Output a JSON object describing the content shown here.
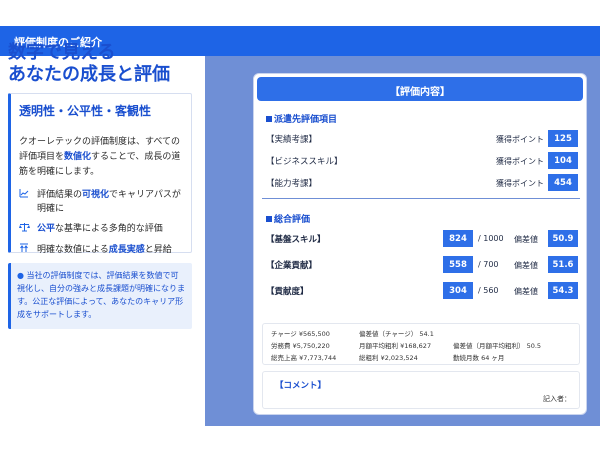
{
  "header": {
    "title": "評価制度のご紹介"
  },
  "left": {
    "headline_line1": "数字で見える",
    "headline_line2": "あなたの成長と評価",
    "card": {
      "title": "透明性・公平性・客観性",
      "desc_a": "クオーレテックの評価制度は、すべての評価項目を",
      "desc_hl": "数値化",
      "desc_b": "することで、成長の道筋を明確にします。",
      "features": [
        {
          "icon": "chart-line-icon",
          "a": "評価結果の",
          "hl": "可視化",
          "b": "でキャリアパスが明確に"
        },
        {
          "icon": "scale-icon",
          "a": "",
          "hl": "公平",
          "b": "な基準による多角的な評価"
        },
        {
          "icon": "stairs-icon",
          "a": "明確な数値による",
          "hl": "成長実感",
          "b": "と昇給"
        }
      ]
    },
    "note": "当社の評価制度では、評価結果を数値で可視化し、自分の強みと成長課題が明確になります。公正な評価によって、あなたのキャリア形成をサポートします。"
  },
  "panel": {
    "title": "【評価内容】",
    "section1": "派遣先評価項目",
    "items": [
      {
        "label": "【実績考課】",
        "points_label": "獲得ポイント",
        "value": "125"
      },
      {
        "label": "【ビジネススキル】",
        "points_label": "獲得ポイント",
        "value": "104"
      },
      {
        "label": "【能力考課】",
        "points_label": "獲得ポイント",
        "value": "454"
      }
    ],
    "section2": "総合評価",
    "totals": [
      {
        "label": "【基盤スキル】",
        "score": "824",
        "max": "/ 1000",
        "dev_label": "偏差値",
        "dev": "50.9"
      },
      {
        "label": "【企業貢献】",
        "score": "558",
        "max": "/ 700",
        "dev_label": "偏差値",
        "dev": "51.6"
      },
      {
        "label": "【貢献度】",
        "score": "304",
        "max": "/ 560",
        "dev_label": "偏差値",
        "dev": "54.3"
      }
    ],
    "stats": {
      "r1c1": "チャージ ¥565,500",
      "r1c2": "偏差値（チャージ） 54.1",
      "r2c1": "労務費 ¥5,750,220",
      "r2c2": "月額平均粗利 ¥168,627",
      "r2c3": "偏差値（月額平均粗利） 50.5",
      "r3c1": "総売上高 ¥7,773,744",
      "r3c2": "総粗利 ¥2,023,524",
      "r3c3": "勤続月数 64 ヶ月"
    },
    "comment_title": "【コメント】",
    "signer": "記入者："
  },
  "colors": {
    "accent": "#1e64e6",
    "panel_bg": "#6f8fd6"
  }
}
